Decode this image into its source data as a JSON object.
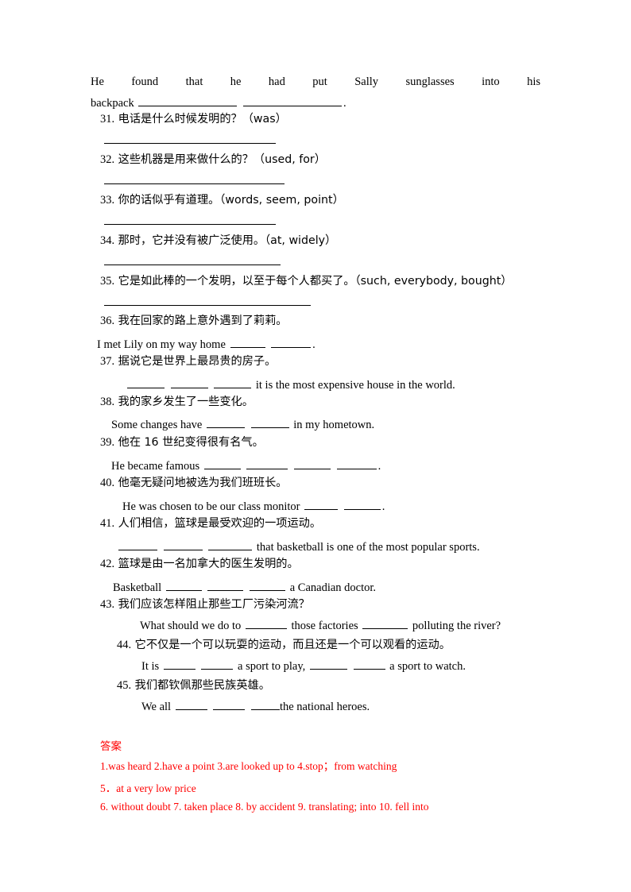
{
  "document": {
    "type": "chinese-english-translation-worksheet",
    "text_color": "#000000",
    "answer_color": "#ff0000"
  },
  "top_sentence": {
    "words": [
      "He",
      "found",
      "that",
      "he",
      "had",
      "put",
      "Sally",
      "sunglasses",
      "into",
      "his"
    ],
    "continuation_label": "backpack",
    "continuation_tail": "."
  },
  "questions": [
    {
      "number": "31.",
      "chinese": "电话是什么时候发明的？（was）",
      "english": "",
      "indent": "normal"
    },
    {
      "number": "32.",
      "chinese": "这些机器是用来做什么的？（used, for）",
      "english": "",
      "indent": "normal"
    },
    {
      "number": "33.",
      "chinese": "你的话似乎有道理。（words, seem, point）",
      "english": "",
      "indent": "normal"
    },
    {
      "number": "34.",
      "chinese": "那时，它并没有被广泛使用。（at, widely）",
      "english": "",
      "indent": "normal"
    },
    {
      "number": "35.",
      "chinese": "它是如此棒的一个发明，以至于每个人都买了。（such, everybody, bought）",
      "english": "",
      "indent": "normal"
    },
    {
      "number": "36.",
      "chinese": "我在回家的路上意外遇到了莉莉。",
      "english_pre": "I met Lily on my way home",
      "english_mid": "",
      "english_post": ".",
      "indent": "normal"
    },
    {
      "number": "37.",
      "chinese": "据说它是世界上最昂贵的房子。",
      "english_pre": "",
      "english_post": "it is the most expensive house in the world.",
      "indent": "normal"
    },
    {
      "number": "38.",
      "chinese": "我的家乡发生了一些变化。",
      "english_pre": "Some changes have",
      "english_post": "in my hometown.",
      "indent": "normal"
    },
    {
      "number": "39.",
      "chinese": "他在 16 世纪变得很有名气。",
      "english_pre": "He became famous",
      "english_post": ".",
      "indent": "normal"
    },
    {
      "number": "40.",
      "chinese": "他毫无疑问地被选为我们班班长。",
      "english_pre": "He was chosen to be our class monitor",
      "english_post": ".",
      "indent": "normal"
    },
    {
      "number": "41.",
      "chinese": "人们相信，篮球是最受欢迎的一项运动。",
      "english_pre": "",
      "english_post": "that basketball is one of the most popular sports.",
      "indent": "normal"
    },
    {
      "number": "42.",
      "chinese": "篮球是由一名加拿大的医生发明的。",
      "english_pre": "Basketball",
      "english_post": "a Canadian doctor.",
      "indent": "normal"
    },
    {
      "number": "43.",
      "chinese": "我们应该怎样阻止那些工厂污染河流？",
      "english_pre": "What should we do to",
      "english_mid": "those factories",
      "english_post": "polluting the river?",
      "indent": "normal"
    },
    {
      "number": "44.",
      "chinese": "它不仅是一个可以玩耍的运动，而且还是一个可以观看的运动。",
      "english_pre": "It is",
      "english_mid": "a sport to play,",
      "english_post": "a sport to watch.",
      "indent": "deep"
    },
    {
      "number": "45.",
      "chinese": "我们都钦佩那些民族英雄。",
      "english_pre": "We all",
      "english_post": "the national heroes.",
      "indent": "deep"
    }
  ],
  "answers": {
    "title": "答案",
    "lines": [
      "1.was heard 2.have a point 3.are looked up to 4.stop；from watching",
      "5．at a very low price",
      "6. without doubt   7. taken place 8. by accident   9. translating; into   10. fell into"
    ]
  }
}
